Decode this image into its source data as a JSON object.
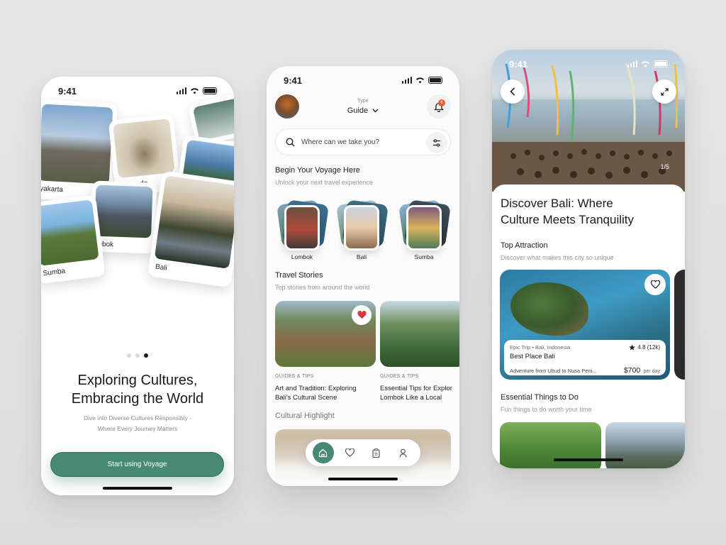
{
  "status_time": "9:41",
  "onboarding": {
    "cards": [
      "yakarta",
      "Komodo",
      "mbok",
      "Sumba",
      "Bali"
    ],
    "title_line1": "Exploring Cultures,",
    "title_line2": "Embracing the World",
    "subtitle_line1": "Dive into Diverse Cultures Responsibly -",
    "subtitle_line2": "Where Every Journey Matters",
    "cta": "Start using Voyage",
    "page_index": 3,
    "page_count": 3
  },
  "home": {
    "type_label": "Type",
    "type_value": "Guide",
    "notification_count": "6",
    "search_placeholder": "Where can we take you?",
    "section1_title": "Begin Your Voyage Here",
    "section1_sub": "Unlock your next travel experience",
    "destinations": [
      "Lombok",
      "Bali",
      "Sumba"
    ],
    "section2_title": "Travel Stories",
    "section2_sub": "Top stories from around the world",
    "stories": [
      {
        "category": "GUIDES & TIPS",
        "title_line1": "Art and Tradition: Exploring",
        "title_line2": "Bali's Cultural Scene"
      },
      {
        "category": "GUIDES & TIPS",
        "title_line1": "Essential Tips for Explor",
        "title_line2": "Lombok Like a Local"
      }
    ],
    "section3_title": "Cultural Highlight",
    "tabs": [
      "home-icon",
      "heart-icon",
      "clipboard-icon",
      "user-icon"
    ]
  },
  "detail": {
    "image_counter": "1/5",
    "title_line1": "Discover Bali: Where",
    "title_line2": "Culture Meets Tranquility",
    "attraction_title": "Top Attraction",
    "attraction_sub": "Discover what makes this city so unique",
    "attraction": {
      "source": "Epic Trip • Bali, Indonesia",
      "rating": "4.8 (12k)",
      "name": "Best Place Bali",
      "desc": "Adventure from Ubud to Nusa Peni...",
      "price": "$700",
      "price_unit": "per day"
    },
    "things_title": "Essential Things to Do",
    "things_sub": "Fun things to do worth your time"
  },
  "colors": {
    "accent": "#468a73",
    "badge": "#e35b3f",
    "heart": "#d63b3b"
  }
}
